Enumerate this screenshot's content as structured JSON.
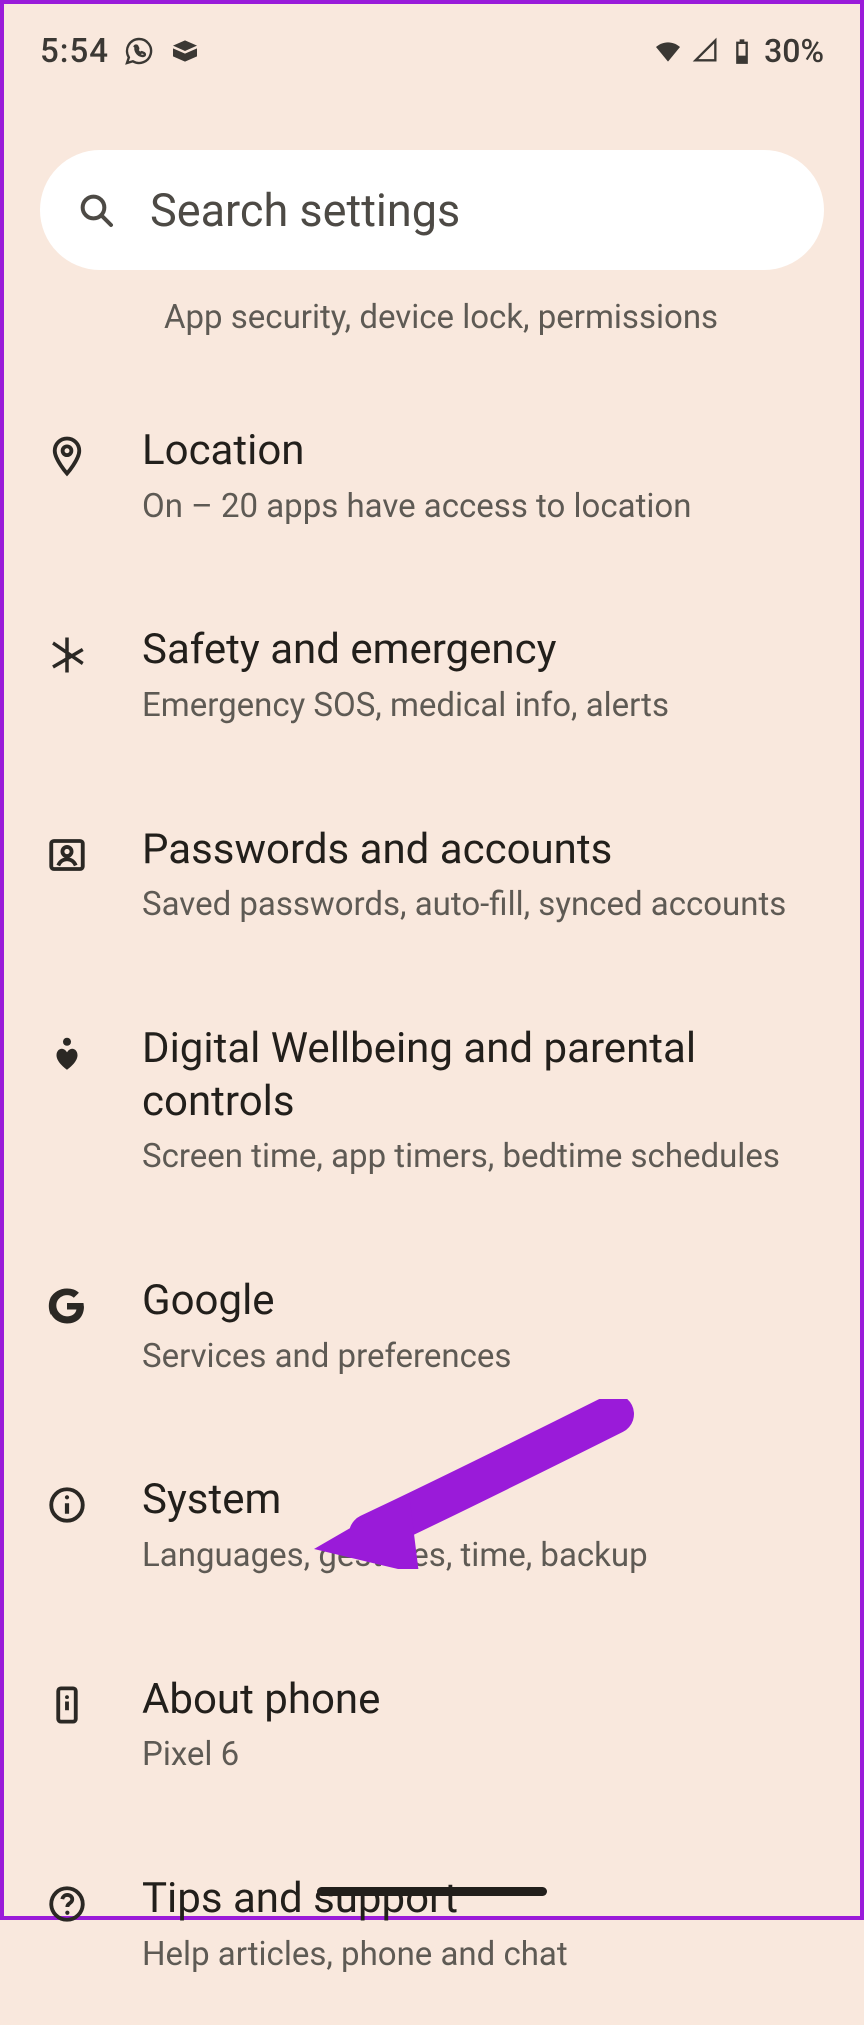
{
  "status_bar": {
    "time": "5:54",
    "battery_text": "30%"
  },
  "search": {
    "placeholder": "Search settings"
  },
  "orphan_subtitle": "App security, device lock, permissions",
  "items": [
    {
      "id": "location",
      "title": "Location",
      "subtitle": "On – 20 apps have access to location"
    },
    {
      "id": "safety",
      "title": "Safety and emergency",
      "subtitle": "Emergency SOS, medical info, alerts"
    },
    {
      "id": "passwords",
      "title": "Passwords and accounts",
      "subtitle": "Saved passwords, auto-fill, synced accounts"
    },
    {
      "id": "wellbeing",
      "title": "Digital Wellbeing and parental controls",
      "subtitle": "Screen time, app timers, bedtime schedules"
    },
    {
      "id": "google",
      "title": "Google",
      "subtitle": "Services and preferences"
    },
    {
      "id": "system",
      "title": "System",
      "subtitle": "Languages, gestures, time, backup"
    },
    {
      "id": "about",
      "title": "About phone",
      "subtitle": "Pixel 6"
    },
    {
      "id": "tips",
      "title": "Tips and support",
      "subtitle": "Help articles, phone and chat"
    }
  ],
  "annotation": {
    "color": "#9a1bd9",
    "target": "system"
  }
}
